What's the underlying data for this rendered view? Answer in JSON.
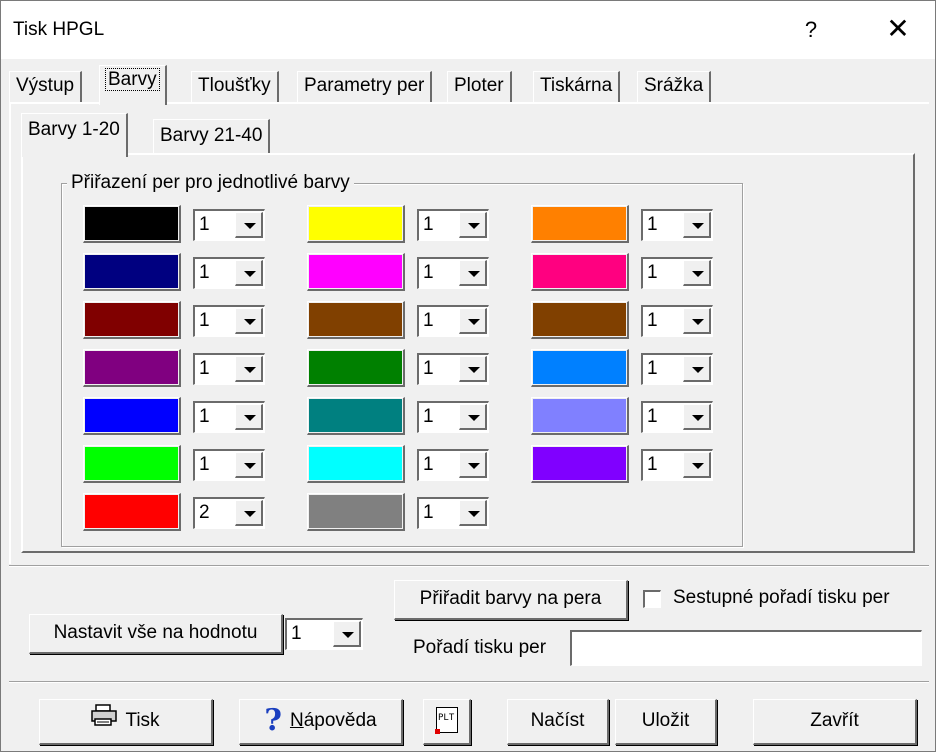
{
  "window": {
    "title": "Tisk HPGL",
    "help_glyph": "?",
    "close_glyph": "✕"
  },
  "tabs": [
    "Výstup",
    "Barvy",
    "Tloušťky",
    "Parametry per",
    "Ploter",
    "Tiskárna",
    "Srážka"
  ],
  "active_tab": "Barvy",
  "subtabs": [
    "Barvy 1-20",
    "Barvy 21-40"
  ],
  "active_subtab": "Barvy 1-20",
  "group_title": "Přiřazení per pro jednotlivé barvy",
  "color_rows": [
    [
      {
        "color": "#000000",
        "pen": "1"
      },
      {
        "color": "#ffff00",
        "pen": "1"
      },
      {
        "color": "#ff8000",
        "pen": "1"
      }
    ],
    [
      {
        "color": "#000080",
        "pen": "1"
      },
      {
        "color": "#ff00ff",
        "pen": "1"
      },
      {
        "color": "#ff0080",
        "pen": "1"
      }
    ],
    [
      {
        "color": "#800000",
        "pen": "1"
      },
      {
        "color": "#804000",
        "pen": "1"
      },
      {
        "color": "#804000",
        "pen": "1"
      }
    ],
    [
      {
        "color": "#800080",
        "pen": "1"
      },
      {
        "color": "#008000",
        "pen": "1"
      },
      {
        "color": "#0080ff",
        "pen": "1"
      }
    ],
    [
      {
        "color": "#0000ff",
        "pen": "1"
      },
      {
        "color": "#008080",
        "pen": "1"
      },
      {
        "color": "#8080ff",
        "pen": "1"
      }
    ],
    [
      {
        "color": "#00ff00",
        "pen": "1"
      },
      {
        "color": "#00ffff",
        "pen": "1"
      },
      {
        "color": "#8000ff",
        "pen": "1"
      }
    ],
    [
      {
        "color": "#ff0000",
        "pen": "2"
      },
      {
        "color": "#808080",
        "pen": "1"
      }
    ]
  ],
  "set_all": {
    "button_label": "Nastavit vše na hodnotu",
    "value": "1"
  },
  "assign_button": "Přiřadit barvy na pera",
  "descending_checkbox": {
    "label": "Sestupné pořadí tisku per",
    "checked": false
  },
  "print_order": {
    "label": "Pořadí tisku per",
    "value": ""
  },
  "bottom_buttons": {
    "print": "Tisk",
    "help_mnemonic": "N",
    "help_rest": "ápověda",
    "plt_icon_text": "PLT",
    "load": "Načíst",
    "save": "Uložit",
    "close": "Zavřít"
  }
}
